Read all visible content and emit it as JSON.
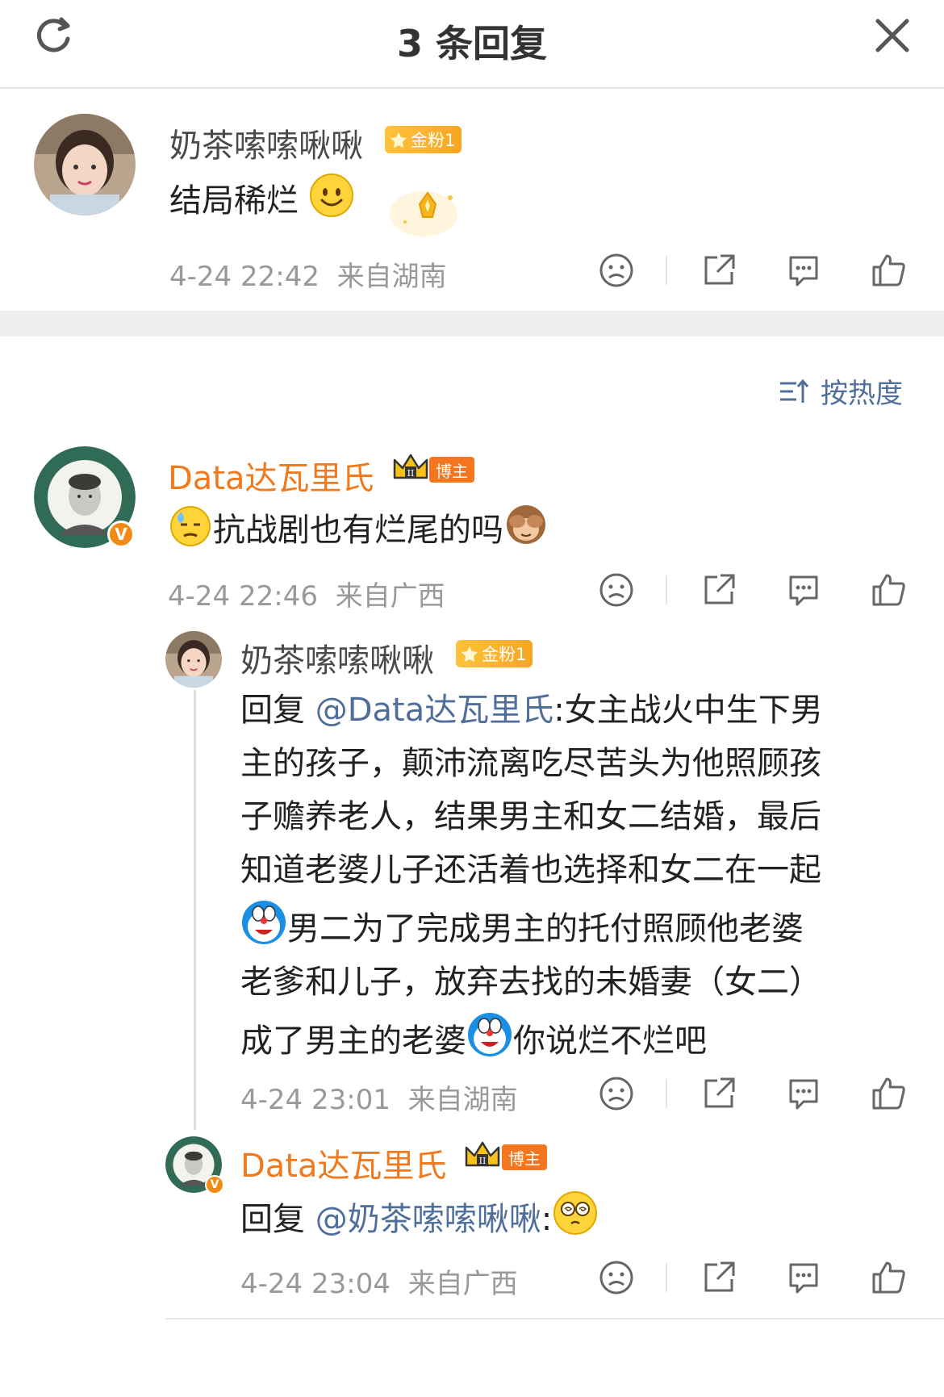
{
  "header": {
    "title": "3 条回复",
    "refresh_icon": "refresh-icon",
    "close_icon": "close-icon"
  },
  "root_comment": {
    "username": "奶茶嗦嗦啾啾",
    "fan_badge": "金粉1",
    "text": "结局稀烂",
    "emoji": "smile-emoji",
    "time": "4-24 22:42",
    "location": "来自湖南"
  },
  "sort_label": "按热度",
  "comments": [
    {
      "username": "Data达瓦里氏",
      "badge": "博主",
      "crown_level": "II",
      "verified": "V",
      "text": "抗战剧也有烂尾的吗",
      "time": "4-24 22:46",
      "location": "来自广西"
    },
    {
      "username": "奶茶嗦嗦啾啾",
      "fan_badge": "金粉1",
      "reply_prefix": "回复 ",
      "mention": "@Data达瓦里氏",
      "lines": [
        ":女主战火中生下男",
        "主的孩子，颠沛流离吃尽苦头为他照顾孩",
        "子赡养老人，结果男主和女二结婚，最后",
        "知道老婆儿子还活着也选择和女二在一起",
        "男二为了完成男主的托付照顾他老婆",
        "老爹和儿子，放弃去找的未婚妻（女二）",
        "成了男主的老婆",
        "你说烂不烂吧"
      ],
      "time": "4-24 23:01",
      "location": "来自湖南"
    },
    {
      "username": "Data达瓦里氏",
      "badge": "博主",
      "crown_level": "II",
      "verified": "V",
      "reply_prefix": "回复 ",
      "mention": "@奶茶嗦嗦啾啾",
      "colon": ":",
      "time": "4-24 23:04",
      "location": "来自广西"
    }
  ],
  "colors": {
    "accent_orange": "#f07a1e",
    "mention_blue": "#4f6f9a",
    "meta_gray": "#999999"
  }
}
